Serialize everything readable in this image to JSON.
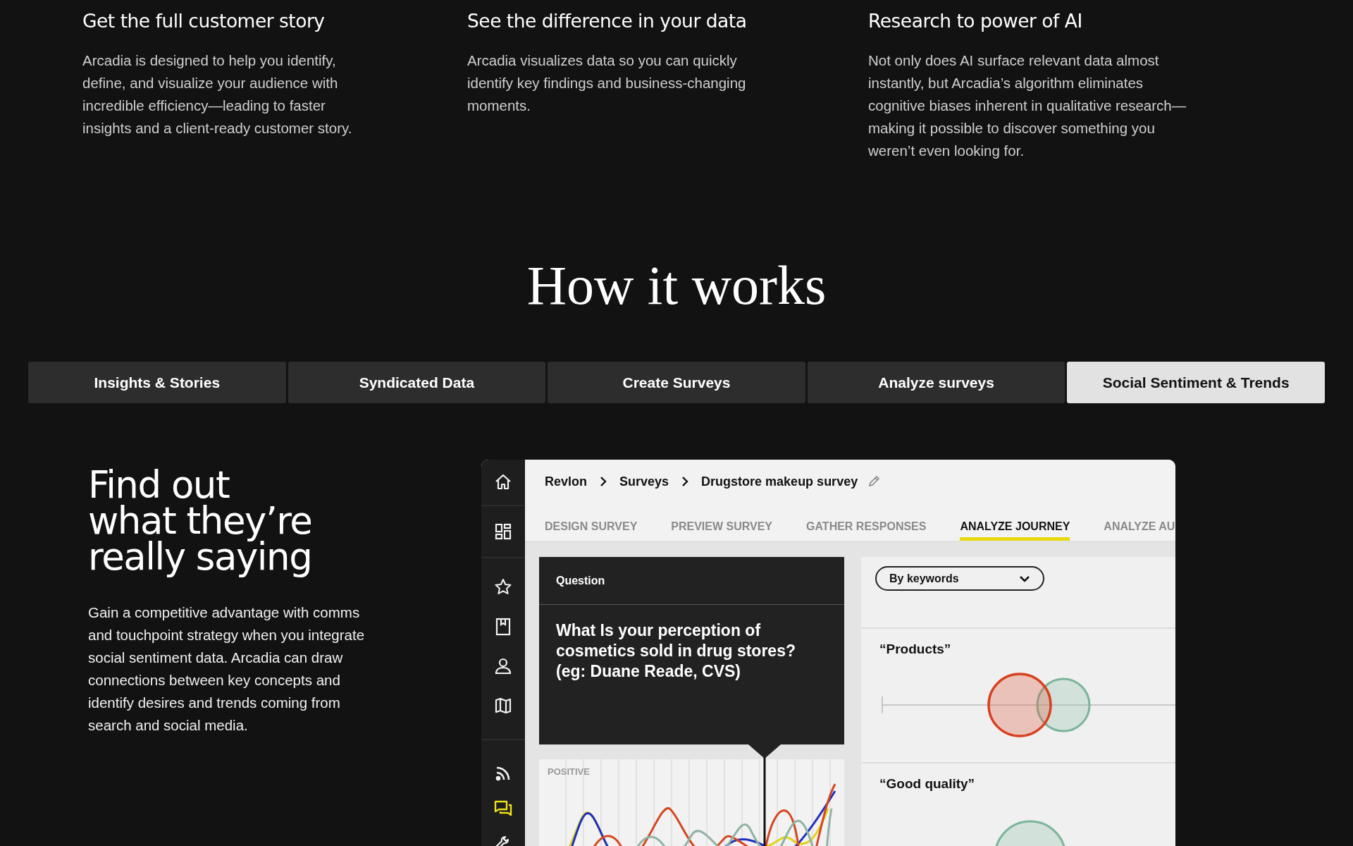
{
  "features": [
    {
      "title": "Get the full customer story",
      "text": "Arcadia is designed to help you identify, define, and visualize your audience with incredible efficiency—leading to faster insights and a client-ready customer story."
    },
    {
      "title": "See the difference in your data",
      "text": "Arcadia visualizes data so you can quickly identify key findings and business-changing moments."
    },
    {
      "title": "Research to power of AI",
      "text": "Not only does AI surface relevant data almost instantly, but Arcadia’s algorithm eliminates cognitive biases inherent in qualitative research—making it possible to discover something you weren’t even looking for."
    }
  ],
  "section_title": "How it works",
  "tabs": [
    {
      "label": "Insights & Stories",
      "selected": false
    },
    {
      "label": "Syndicated Data",
      "selected": false
    },
    {
      "label": "Create Surveys",
      "selected": false
    },
    {
      "label": "Analyze surveys",
      "selected": false
    },
    {
      "label": "Social Sentiment & Trends",
      "selected": true
    }
  ],
  "panel": {
    "heading": "Find out\nwhat they’re\nreally saying",
    "text": "Gain a competitive advantage with comms and touchpoint strategy when you integrate social sentiment data. Arcadia can draw connections between key concepts and identify desires and trends coming from search and social media."
  },
  "app": {
    "sidebar": [
      {
        "items": [
          {
            "kind": "home",
            "selected": false
          }
        ]
      },
      {
        "items": [
          {
            "kind": "dashboard",
            "selected": false
          }
        ]
      },
      {
        "items": [
          {
            "kind": "star",
            "selected": false
          },
          {
            "kind": "bookmark",
            "selected": false
          },
          {
            "kind": "person",
            "selected": false
          },
          {
            "kind": "map",
            "selected": false
          }
        ]
      },
      {
        "items": [
          {
            "kind": "rss",
            "selected": false
          },
          {
            "kind": "chat",
            "selected": true
          },
          {
            "kind": "tool",
            "selected": false
          }
        ]
      }
    ],
    "breadcrumb": [
      "Revlon",
      "Surveys",
      "Drugstore makeup survey"
    ],
    "tabs": [
      {
        "label": "DESIGN SURVEY",
        "selected": false
      },
      {
        "label": "PREVIEW SURVEY",
        "selected": false
      },
      {
        "label": "GATHER RESPONSES",
        "selected": false
      },
      {
        "label": "ANALYZE JOURNEY",
        "selected": true
      },
      {
        "label": "ANALYZE AU",
        "selected": false
      }
    ],
    "question": {
      "label": "Question",
      "text": "What Is your perception of cosmetics sold in drug stores? (eg: Duane Reade, CVS)"
    },
    "chart_label": "POSITIVE",
    "filter": "By keywords",
    "keywords": [
      "“Products”",
      "“Good quality”"
    ]
  }
}
